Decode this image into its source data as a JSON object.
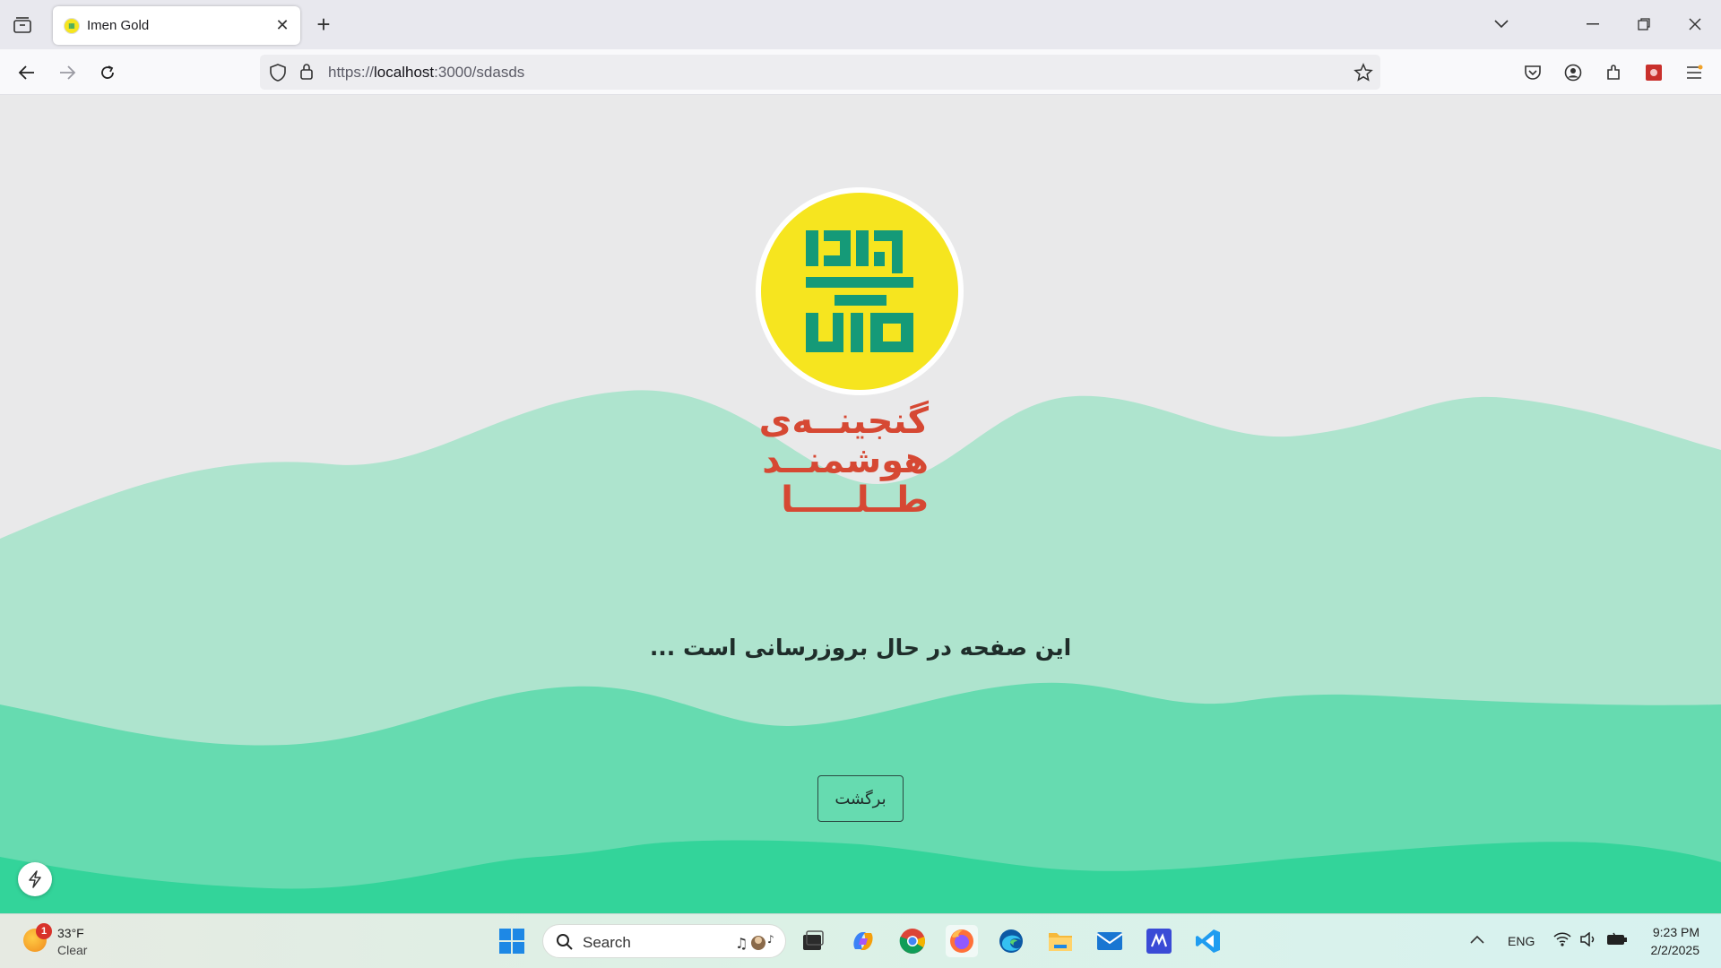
{
  "browser": {
    "tab_title": "Imen Gold",
    "url_prefix": "https://",
    "url_host": "localhost",
    "url_rest": ":3000/sdasds"
  },
  "page": {
    "brand_lines": [
      "گنجینــه‌ی",
      "هوشمنــد",
      "طــلـــــا"
    ],
    "message": "این صفحه در حال بروزرسانی است ...",
    "back_button": "برگشت",
    "colors": {
      "background": "#e9e9ea",
      "wave_light": "#aee4ce",
      "wave_mid": "#66dbb0",
      "wave_dark": "#33d49a",
      "logo_yellow": "#f6e51f",
      "logo_green": "#159a78",
      "brand_red": "#d64833"
    }
  },
  "taskbar": {
    "weather_temp": "33°F",
    "weather_condition": "Clear",
    "weather_badge": "1",
    "search_label": "Search",
    "language": "ENG",
    "time": "9:23 PM",
    "date": "2/2/2025"
  }
}
